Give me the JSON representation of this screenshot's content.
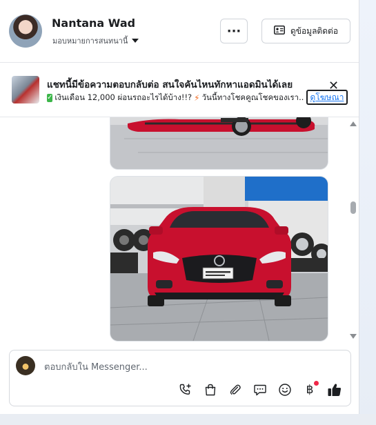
{
  "header": {
    "name": "Nantana Wad",
    "assign_label": "มอบหมายการสนทนานี้",
    "more_label": "···",
    "contact_label": "ดูข้อมูลติดต่อ"
  },
  "ad": {
    "title": "แชทนี้มีข้อความตอบกลับต่อ สนใจคันไหนทักหาแอดมินได้เลย",
    "subtitle_part1": "เงินเดือน 12,000 ผ่อนรถอะไรได้บ้าง!!?",
    "subtitle_part2": "วันนี้ทางโชคคูณโชคของเรา...",
    "link_label": "ดูโฆษณา",
    "close_label": "✕"
  },
  "composer": {
    "placeholder": "ตอบกลับใน Messenger...",
    "baht_symbol": "฿"
  },
  "colors": {
    "accent": "#1877f2",
    "car_red": "#c8102e",
    "notification": "#f02849"
  },
  "icons": [
    "id-card-icon",
    "phone-plus-icon",
    "shopping-bag-icon",
    "paperclip-icon",
    "chat-bubble-icon",
    "emoji-icon",
    "thumbs-up-icon"
  ]
}
